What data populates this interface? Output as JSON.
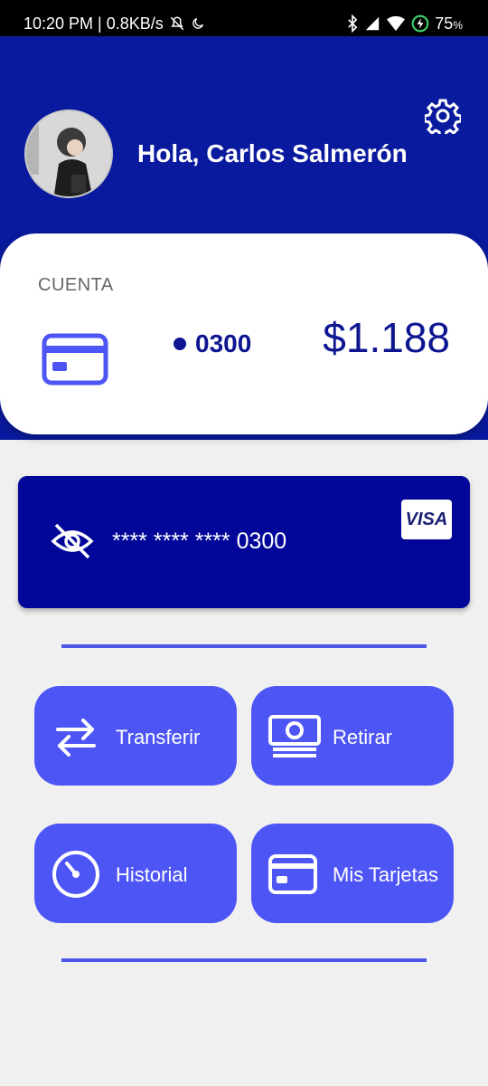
{
  "status_bar": {
    "time_speed": "10:20 PM | 0.8KB/s",
    "battery": "75",
    "battery_unit": "%"
  },
  "header": {
    "greeting": "Hola, Carlos Salmerón"
  },
  "account": {
    "label": "CUENTA",
    "number": "0300",
    "balance": "$1.188"
  },
  "card": {
    "masked_number": "**** **** **** 0300",
    "brand": "VISA"
  },
  "actions": [
    {
      "label": "Transferir",
      "icon": "transfer-arrows-icon"
    },
    {
      "label": "Retirar",
      "icon": "cash-icon"
    },
    {
      "label": "Historial",
      "icon": "timer-icon"
    },
    {
      "label": "Mis Tarjetas",
      "icon": "credit-card-icon"
    }
  ],
  "colors": {
    "header_bg": "#0a1a9e",
    "card_bg": "#02079a",
    "action_bg": "#4e55f5",
    "accent_text": "#0d1690"
  }
}
